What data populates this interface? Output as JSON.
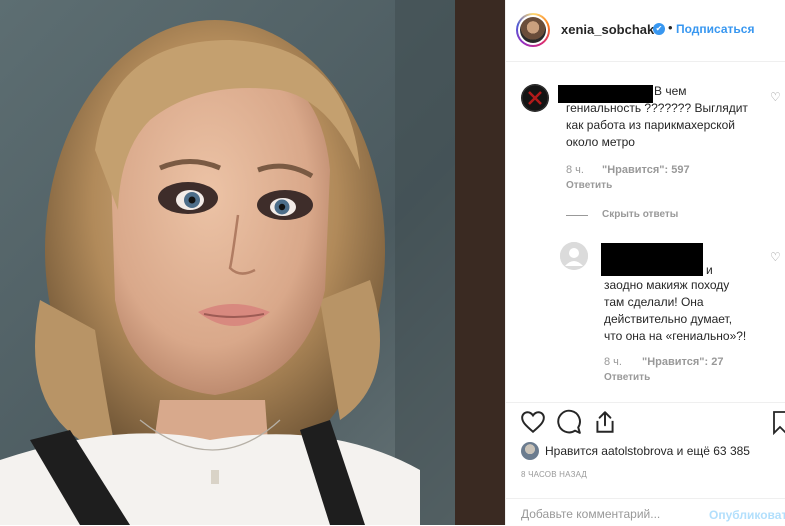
{
  "header": {
    "username": "xenia_sobchak",
    "verified_icon": "check-badge-icon",
    "separator": "•",
    "follow_label": "Подписаться"
  },
  "comments": [
    {
      "text": "В чем\nгениальность ??????? Выглядит\nкак работа из парикмахерской\nоколо метро",
      "time": "8 ч.",
      "likes": "\"Нравится\": 597",
      "reply": "Ответить"
    }
  ],
  "hide_replies": "Скрыть ответы",
  "replies": [
    {
      "text_prefix": "и",
      "text": "заодно макияж походу\nтам сделали! Она\nдействительно думает,\nчто она на «гениально»?!",
      "time": "8 ч.",
      "likes": "\"Нравится\": 27",
      "reply": "Ответить"
    }
  ],
  "likes_summary": "Нравится aatolstobrova и ещё 63 385",
  "time_ago": "8 ЧАСОВ НАЗАД",
  "add_comment": {
    "placeholder": "Добавьте комментарий...",
    "publish_label": "Опубликовать"
  },
  "colors": {
    "link": "#3897f0",
    "muted": "#999999",
    "publish_disabled": "#b2dffc"
  }
}
